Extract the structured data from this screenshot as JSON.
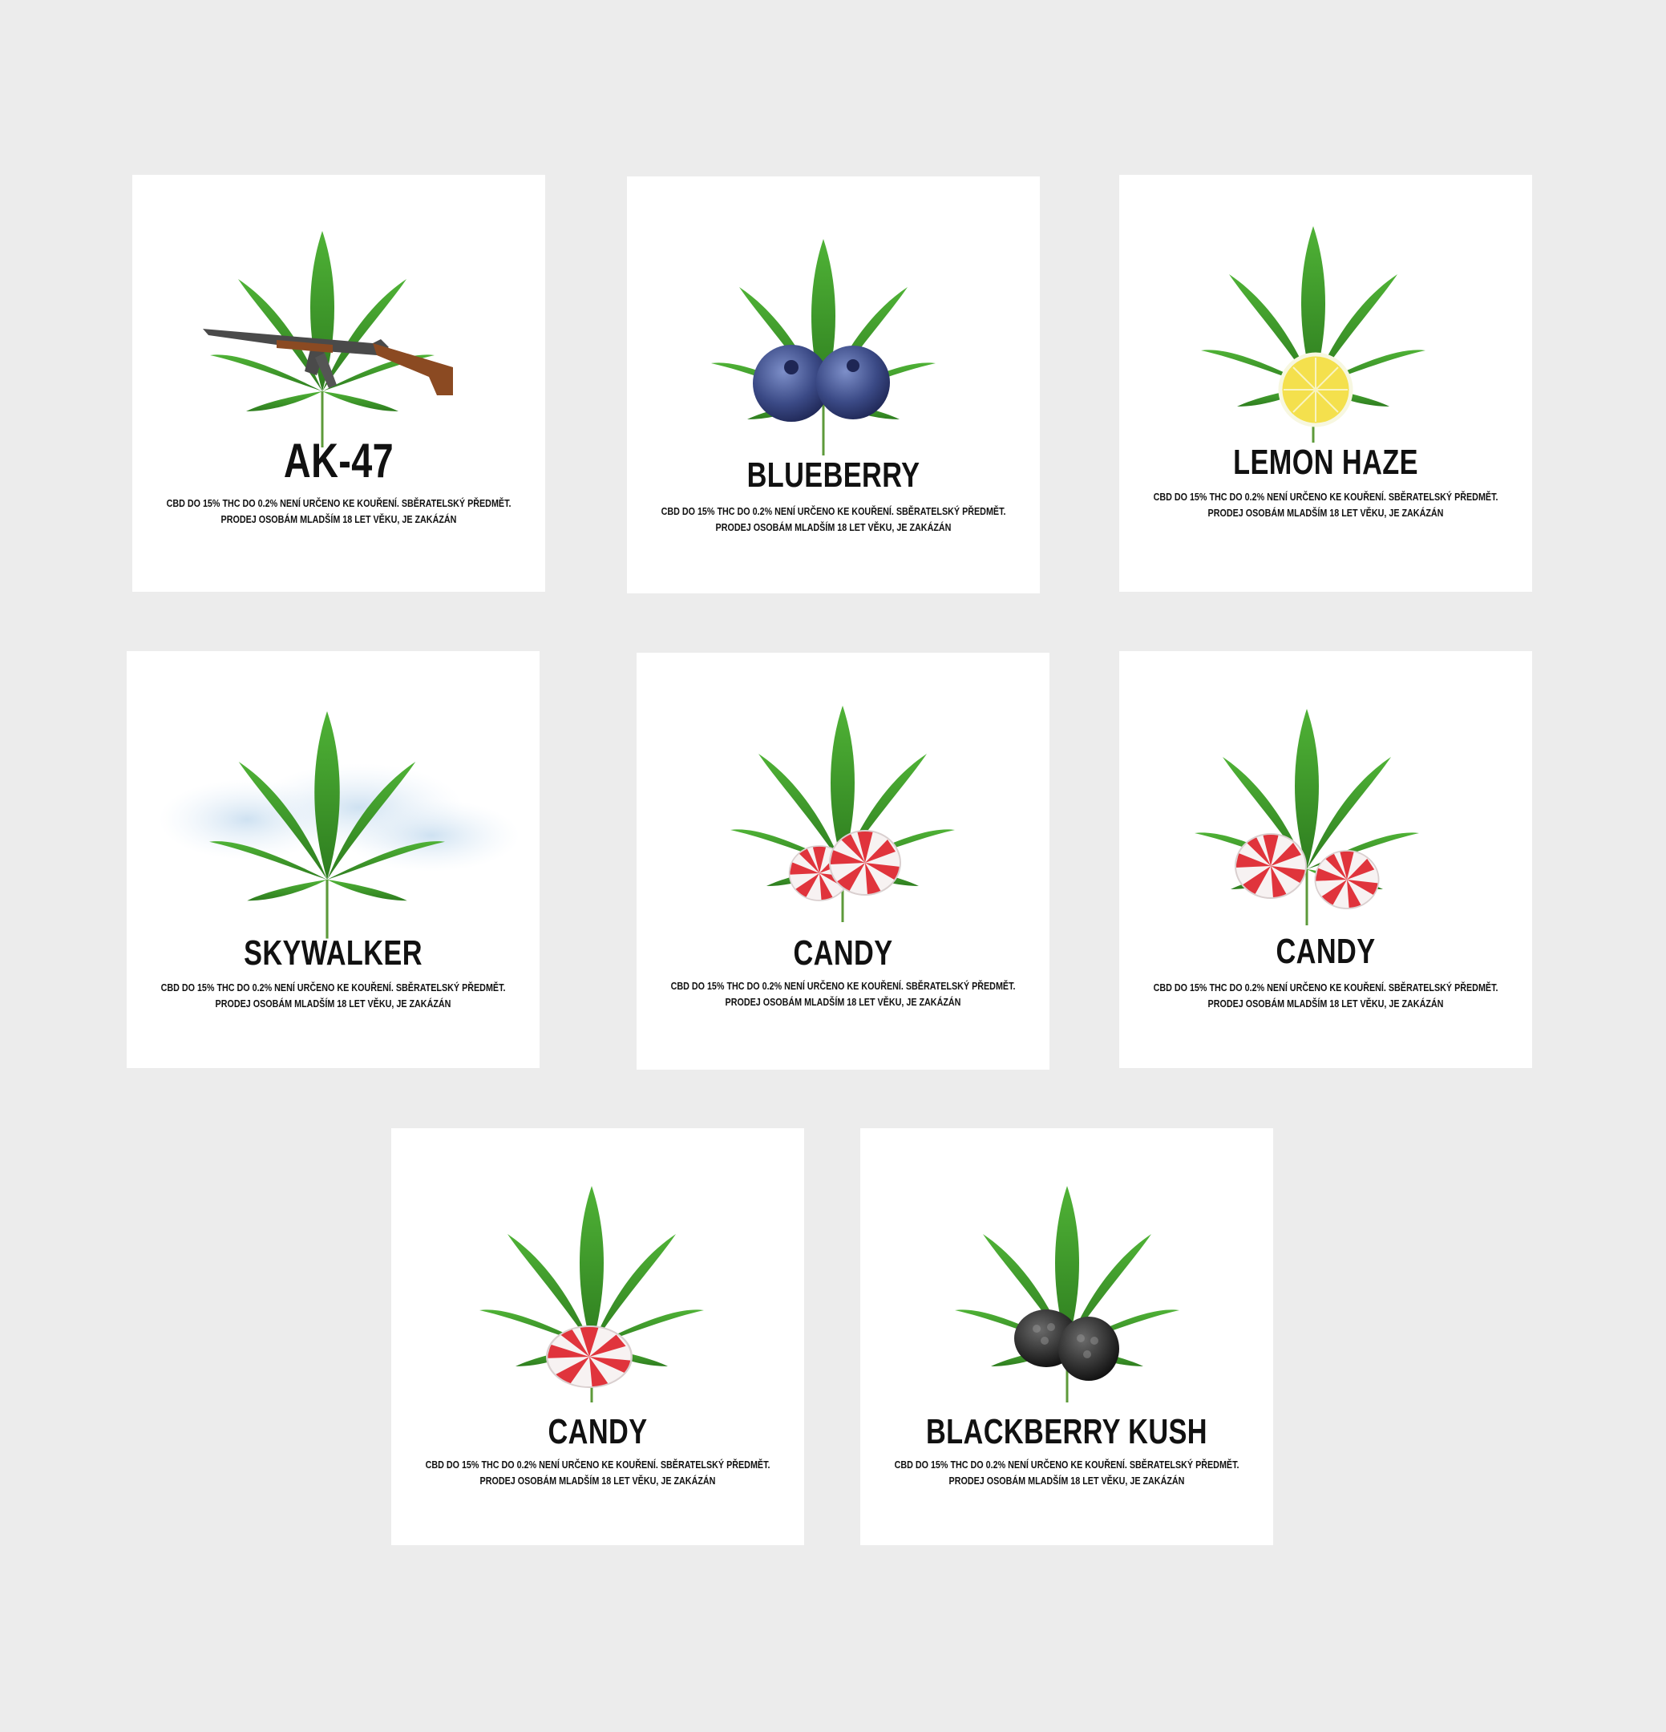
{
  "disclaimer": {
    "line1": "CBD DO 15% THC DO 0.2% NENÍ URČENO KE KOUŘENÍ. SBĚRATELSKÝ PŘEDMĚT.",
    "line2": "PRODEJ OSOBÁM MLADŠÍM 18 LET VĚKU, JE ZAKÁZÁN"
  },
  "labels": [
    {
      "name": "AK-47",
      "overlay": "rifle-icon"
    },
    {
      "name": "BLUEBERRY",
      "overlay": "blueberry-icon"
    },
    {
      "name": "LEMON HAZE",
      "overlay": "lemon-slice-icon"
    },
    {
      "name": "SKYWALKER",
      "overlay": "cloud-icon"
    },
    {
      "name": "CANDY",
      "overlay": "peppermint-candy-icon"
    },
    {
      "name": "CANDY",
      "overlay": "peppermint-candy-icon"
    },
    {
      "name": "CANDY",
      "overlay": "peppermint-candy-icon"
    },
    {
      "name": "BLACKBERRY KUSH",
      "overlay": "blackberry-icon"
    }
  ],
  "colors": {
    "background": "#ececec",
    "card": "#ffffff",
    "leaf": "#3f9a2c",
    "text": "#111111"
  }
}
